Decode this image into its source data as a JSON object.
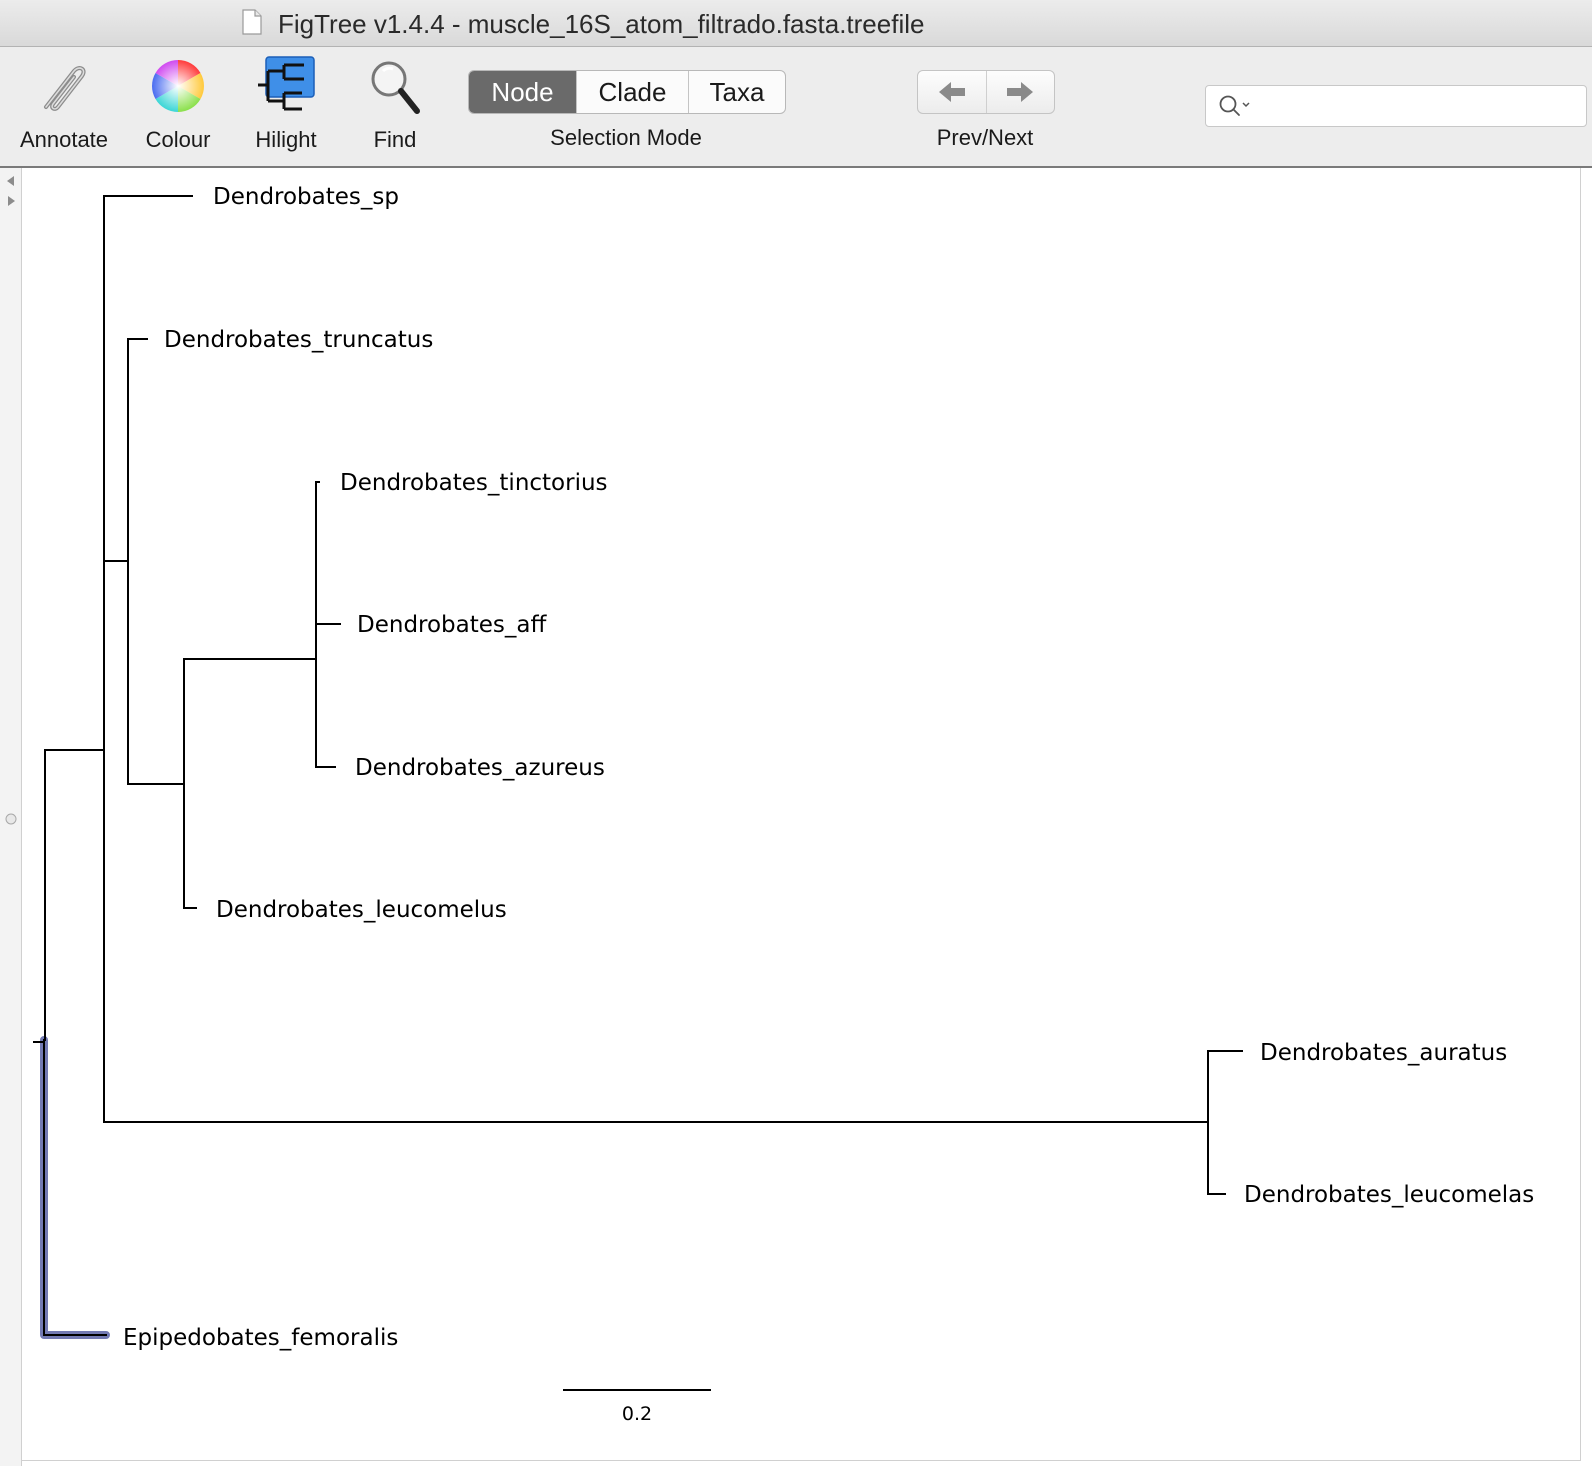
{
  "window": {
    "title": "FigTree v1.4.4 - muscle_16S_atom_filtrado.fasta.treefile"
  },
  "toolbar": {
    "annotate_label": "Annotate",
    "colour_label": "Colour",
    "hilight_label": "Hilight",
    "find_label": "Find",
    "selection_mode": {
      "options": [
        "Node",
        "Clade",
        "Taxa"
      ],
      "selected": "Node",
      "caption": "Selection Mode"
    },
    "prev_next_caption": "Prev/Next",
    "search": {
      "value": "",
      "placeholder": ""
    }
  },
  "tree": {
    "taxa": [
      "Dendrobates_sp",
      "Dendrobates_truncatus",
      "Dendrobates_tinctorius",
      "Dendrobates_aff",
      "Dendrobates_azureus",
      "Dendrobates_leucomelus",
      "Dendrobates_auratus",
      "Dendrobates_leucomelas",
      "Epipedobates_femoralis"
    ],
    "selected_branch": "Epipedobates_femoralis",
    "selection_color": "#5a63a6",
    "branch_color": "#000000",
    "scale_bar_label": "0.2"
  }
}
